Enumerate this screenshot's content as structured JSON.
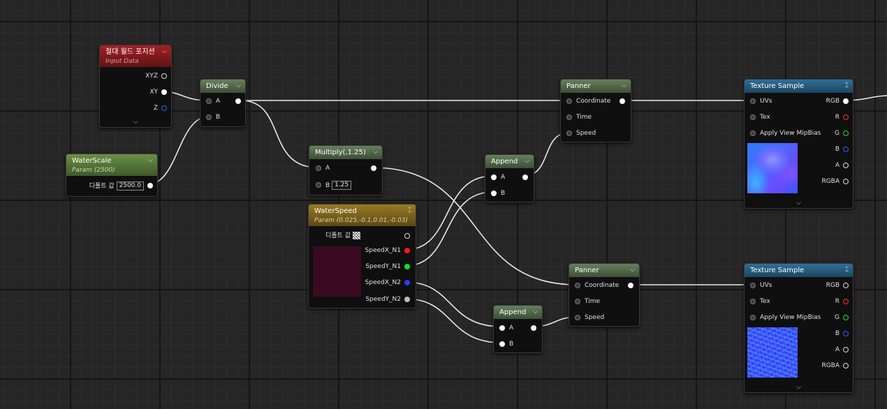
{
  "nodes": {
    "absolute_world_position": {
      "title": "절대 월드 포지션",
      "subtitle": "Input Data",
      "outputs": [
        "XYZ",
        "XY",
        "Z"
      ]
    },
    "water_scale": {
      "title": "WaterScale",
      "subtitle": "Param (2500)",
      "default_label": "디폴트 값",
      "default_value": "2500.0"
    },
    "divide": {
      "title": "Divide",
      "input_a": "A",
      "input_b": "B"
    },
    "multiply": {
      "title": "Multiply(,1.25)",
      "input_a": "A",
      "input_b": "B",
      "b_value": "1.25"
    },
    "water_speed": {
      "title": "WaterSpeed",
      "subtitle": "Param (0.025,-0.1,0.01,-0.03)",
      "default_label": "디폴트 값",
      "outputs": [
        "SpeedX_N1",
        "SpeedY_N1",
        "SpeedX_N2",
        "SpeedY_N2"
      ],
      "swatch_color": "#3a0a23"
    },
    "append_1": {
      "title": "Append",
      "input_a": "A",
      "input_b": "B"
    },
    "append_2": {
      "title": "Append",
      "input_a": "A",
      "input_b": "B"
    },
    "panner_1": {
      "title": "Panner",
      "inputs": [
        "Coordinate",
        "Time",
        "Speed"
      ]
    },
    "panner_2": {
      "title": "Panner",
      "inputs": [
        "Coordinate",
        "Time",
        "Speed"
      ]
    },
    "texture_sample_1": {
      "title": "Texture Sample",
      "inputs": [
        "UVs",
        "Tex",
        "Apply View MipBias"
      ],
      "outputs": [
        "RGB",
        "R",
        "G",
        "B",
        "A",
        "RGBA"
      ]
    },
    "texture_sample_2": {
      "title": "Texture Sample",
      "inputs": [
        "UVs",
        "Tex",
        "Apply View MipBias"
      ],
      "outputs": [
        "RGB",
        "R",
        "G",
        "B",
        "A",
        "RGBA"
      ]
    }
  },
  "icons": {
    "collapse": "chevron-down-icon",
    "expand": "chevron-up-icon",
    "footer": "chevron-down-icon"
  },
  "colors": {
    "graph_background": "#262626",
    "wire": "#e8e8e8",
    "pin_red": "#ff2a2a",
    "pin_green": "#22dd22",
    "pin_blue": "#3a5cff"
  }
}
